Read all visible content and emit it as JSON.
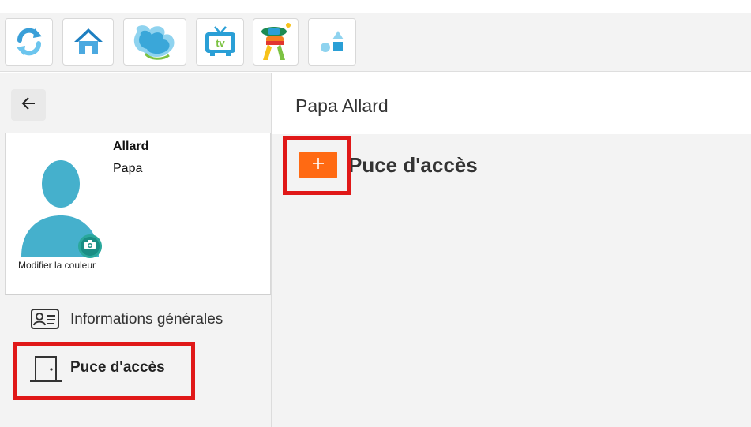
{
  "toolbar": {
    "buttons": [
      {
        "name": "refresh-icon"
      },
      {
        "name": "home-icon"
      },
      {
        "name": "cloud-app-icon"
      },
      {
        "name": "tv-icon"
      },
      {
        "name": "character-app-icon"
      },
      {
        "name": "shapes-icon"
      }
    ]
  },
  "sidebar": {
    "back_icon": "arrow-left-icon",
    "profile": {
      "last_name": "Allard",
      "first_name": "Papa",
      "modify_color": "Modifier la couleur",
      "avatar_color": "#45b0cc"
    },
    "menu": [
      {
        "label": "Informations générales",
        "icon": "id-card-icon"
      },
      {
        "label": "Puce d'accès",
        "icon": "door-icon",
        "active": true
      }
    ]
  },
  "main": {
    "title": "Papa Allard",
    "section_title": "Puce d'accès",
    "add_icon": "plus-icon"
  },
  "colors": {
    "accent": "#ff6a13",
    "highlight": "#e01818",
    "teal": "#1a8d84"
  }
}
